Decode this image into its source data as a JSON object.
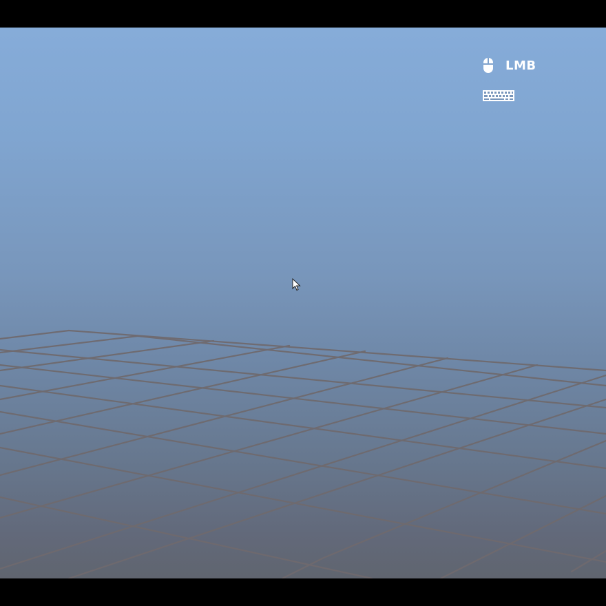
{
  "hud": {
    "mouse_button_label": "LMB",
    "mouse_icon": "mouse-icon",
    "keyboard_icon": "keyboard-icon"
  },
  "viewport": {
    "cursor_icon": "pointer-cursor-icon",
    "ground_grid": "visible"
  },
  "colors": {
    "sky_top": "#86acd9",
    "sky_bottom": "#60656f",
    "grid_line": "#6f6a6e",
    "hud_text": "#ffffff",
    "letterbox": "#000000"
  }
}
